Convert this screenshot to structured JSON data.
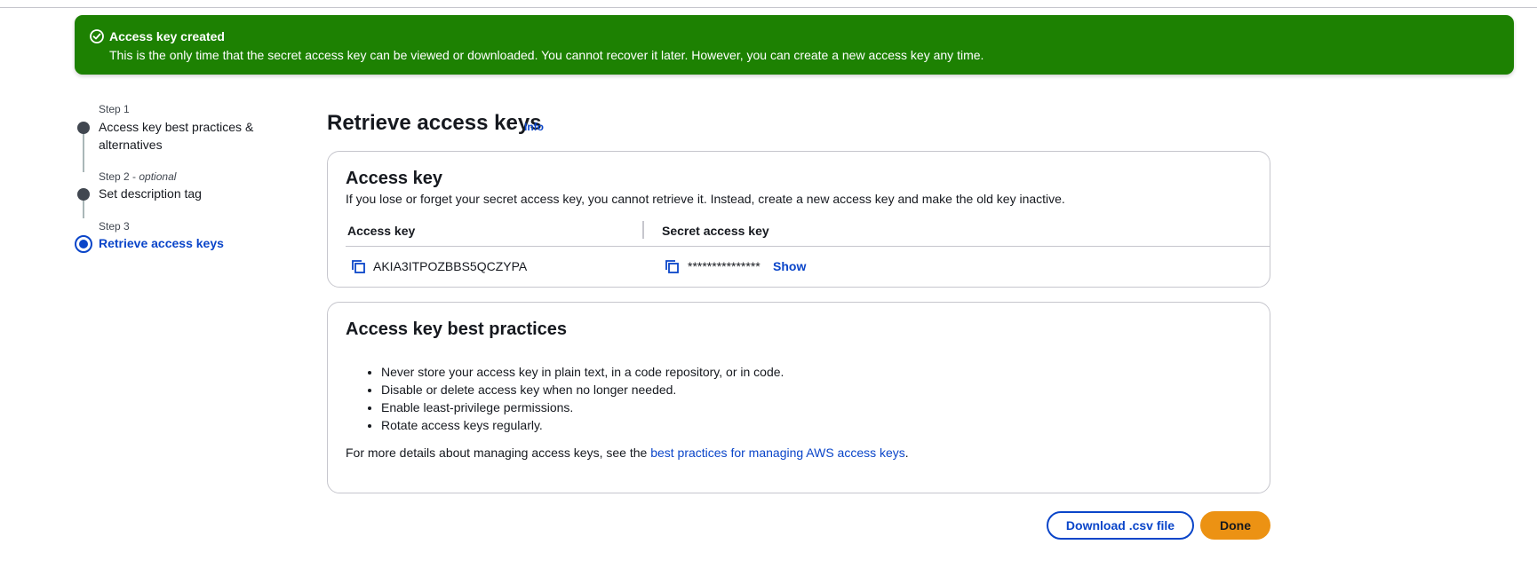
{
  "banner": {
    "title": "Access key created",
    "message": "This is the only time that the secret access key can be viewed or downloaded. You cannot recover it later. However, you can create a new access key any time.",
    "icon": "check-circle-icon",
    "color": "#1d8102"
  },
  "steps": [
    {
      "label": "Step 1",
      "optional": "",
      "title": "Access key best practices & alternatives",
      "active": false
    },
    {
      "label": "Step 2",
      "optional": "optional",
      "title": "Set description tag",
      "active": false
    },
    {
      "label": "Step 3",
      "optional": "",
      "title": "Retrieve access keys",
      "active": true
    }
  ],
  "main": {
    "title": "Retrieve access keys",
    "info_label": "Info"
  },
  "access_key_card": {
    "title": "Access key",
    "description": "If you lose or forget your secret access key, you cannot retrieve it. Instead, create a new access key and make the old key inactive.",
    "columns": [
      "Access key",
      "Secret access key"
    ],
    "access_key_value": "AKIA3ITPOZBBS5QCZYPA",
    "secret_masked": "***************",
    "show_label": "Show"
  },
  "best_practices_card": {
    "title": "Access key best practices",
    "items": [
      "Never store your access key in plain text, in a code repository, or in code.",
      "Disable or delete access key when no longer needed.",
      "Enable least-privilege permissions.",
      "Rotate access keys regularly."
    ],
    "footer_prefix": "For more details about managing access keys, see the ",
    "footer_link": "best practices for managing AWS access keys",
    "footer_suffix": "."
  },
  "actions": {
    "download_label": "Download .csv file",
    "done_label": "Done"
  },
  "colors": {
    "link": "#0a45c9",
    "primary_button": "#ec9213",
    "text": "#16191f"
  }
}
